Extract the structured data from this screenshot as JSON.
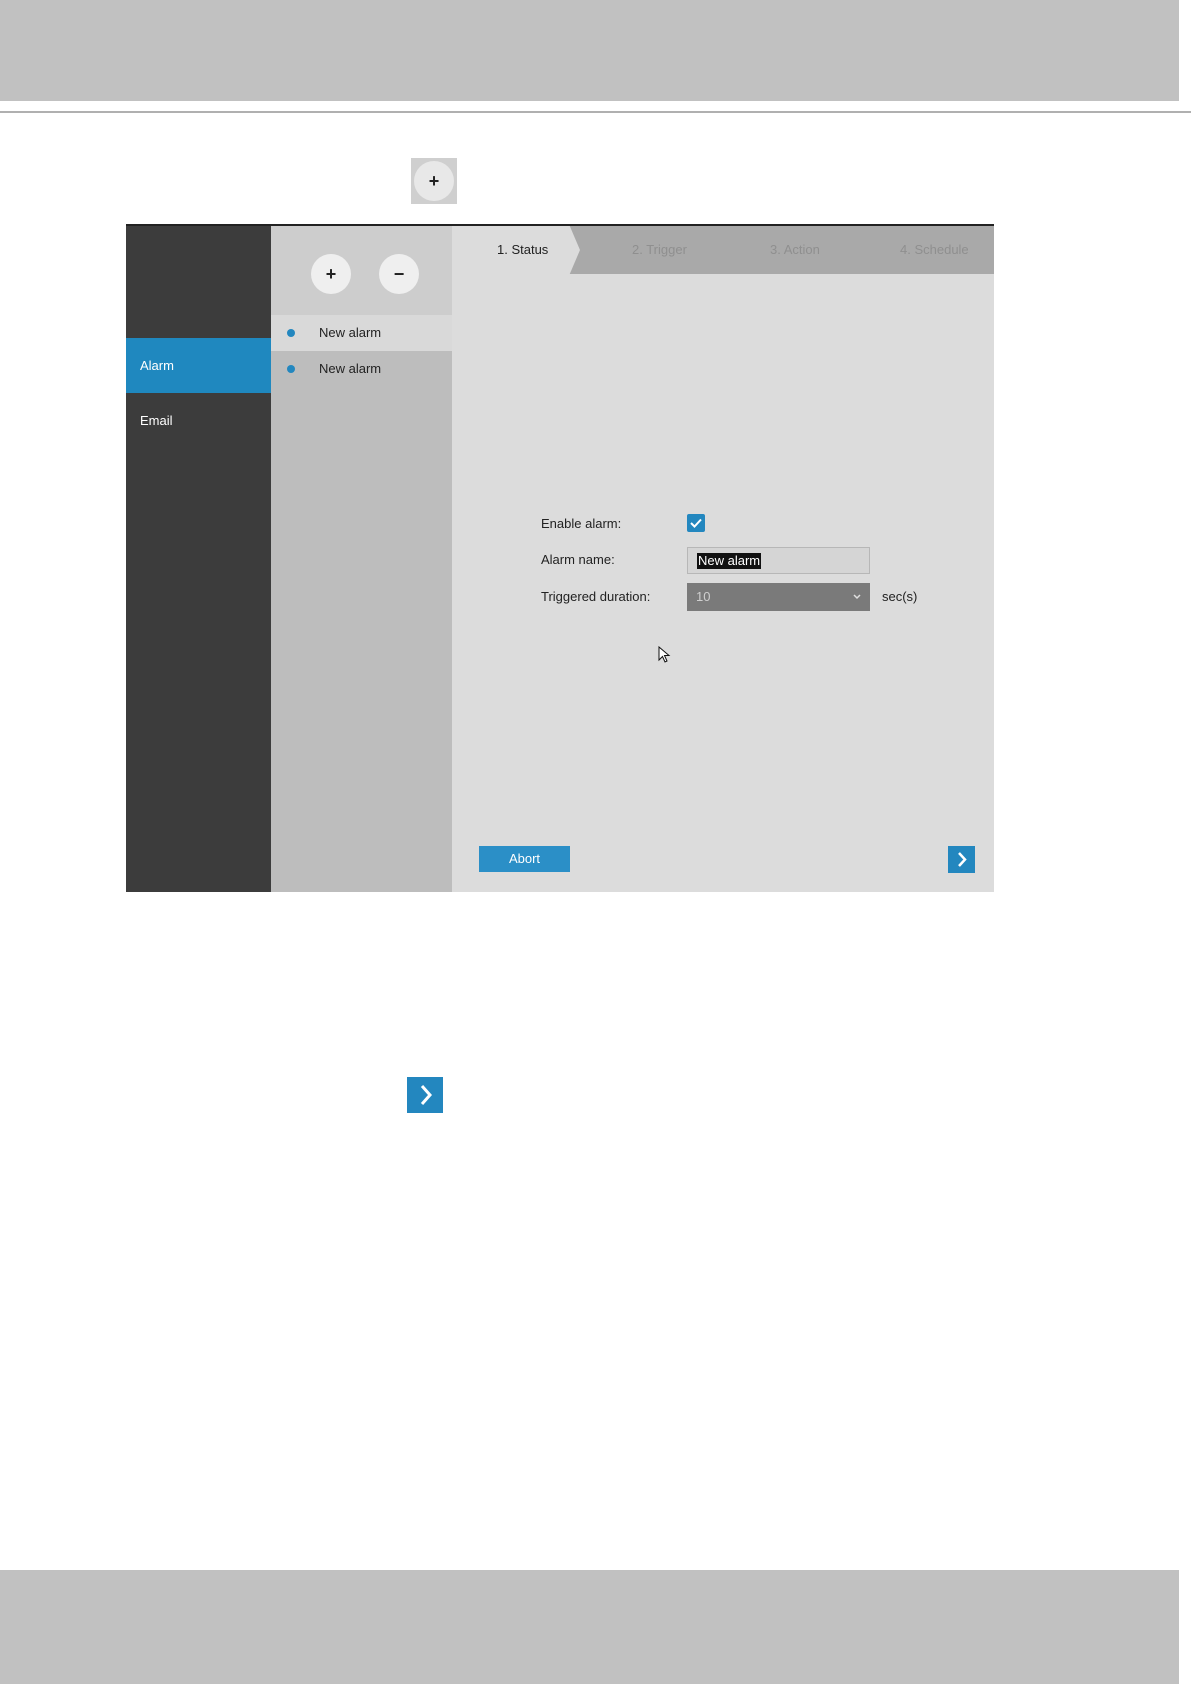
{
  "doc": {
    "add_icon_glyph": "+",
    "next_icon": "chevron-right-icon"
  },
  "app": {
    "nav": [
      {
        "label": "Alarm",
        "selected": true
      },
      {
        "label": "Email",
        "selected": false
      }
    ],
    "list_tools": {
      "add_glyph": "+",
      "remove_glyph": "−"
    },
    "alarms": [
      {
        "label": "New alarm",
        "selected": true
      },
      {
        "label": "New alarm",
        "selected": false
      }
    ],
    "steps": [
      {
        "label": "1. Status",
        "active": true
      },
      {
        "label": "2. Trigger",
        "active": false
      },
      {
        "label": "3. Action",
        "active": false
      },
      {
        "label": "4. Schedule",
        "active": false
      }
    ],
    "form": {
      "enable_label": "Enable alarm:",
      "enable_checked": true,
      "name_label": "Alarm name:",
      "name_value": "New alarm",
      "duration_label": "Triggered duration:",
      "duration_value": "10",
      "duration_unit": "sec(s)"
    },
    "abort_label": "Abort",
    "colors": {
      "accent": "#2387bf",
      "nav_bg": "#3c3c3c",
      "list_bg": "#bdbdbd",
      "panel_bg": "#dcdcdc",
      "band_gray": "#c1c1c1"
    }
  }
}
